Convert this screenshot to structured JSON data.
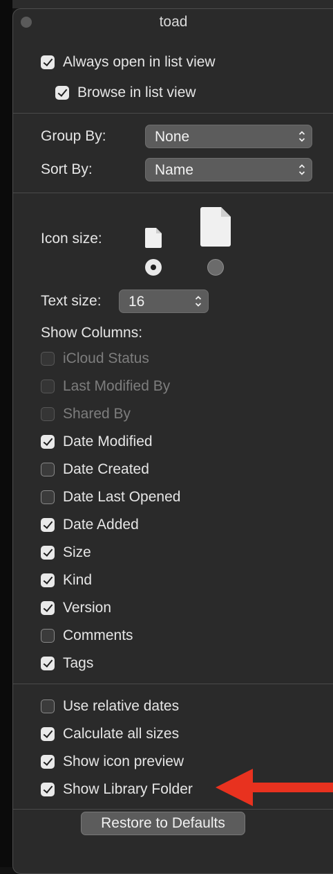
{
  "window": {
    "title": "toad"
  },
  "view_options": {
    "always_open_list": {
      "label": "Always open in list view",
      "checked": true
    },
    "browse_list": {
      "label": "Browse in list view",
      "checked": true
    }
  },
  "grouping": {
    "group_by": {
      "label": "Group By:",
      "value": "None"
    },
    "sort_by": {
      "label": "Sort By:",
      "value": "Name"
    }
  },
  "icon_size": {
    "label": "Icon size:",
    "selected": "small"
  },
  "text_size": {
    "label": "Text size:",
    "value": "16"
  },
  "columns": {
    "heading": "Show Columns:",
    "items": [
      {
        "label": "iCloud Status",
        "checked": false,
        "disabled": true
      },
      {
        "label": "Last Modified By",
        "checked": false,
        "disabled": true
      },
      {
        "label": "Shared By",
        "checked": false,
        "disabled": true
      },
      {
        "label": "Date Modified",
        "checked": true,
        "disabled": false
      },
      {
        "label": "Date Created",
        "checked": false,
        "disabled": false
      },
      {
        "label": "Date Last Opened",
        "checked": false,
        "disabled": false
      },
      {
        "label": "Date Added",
        "checked": true,
        "disabled": false
      },
      {
        "label": "Size",
        "checked": true,
        "disabled": false
      },
      {
        "label": "Kind",
        "checked": true,
        "disabled": false
      },
      {
        "label": "Version",
        "checked": true,
        "disabled": false
      },
      {
        "label": "Comments",
        "checked": false,
        "disabled": false
      },
      {
        "label": "Tags",
        "checked": true,
        "disabled": false
      }
    ]
  },
  "options": {
    "items": [
      {
        "label": "Use relative dates",
        "checked": false
      },
      {
        "label": "Calculate all sizes",
        "checked": true
      },
      {
        "label": "Show icon preview",
        "checked": true
      },
      {
        "label": "Show Library Folder",
        "checked": true
      }
    ]
  },
  "footer": {
    "restore_label": "Restore to Defaults"
  },
  "annotation": {
    "arrow_color": "#e8321f"
  }
}
